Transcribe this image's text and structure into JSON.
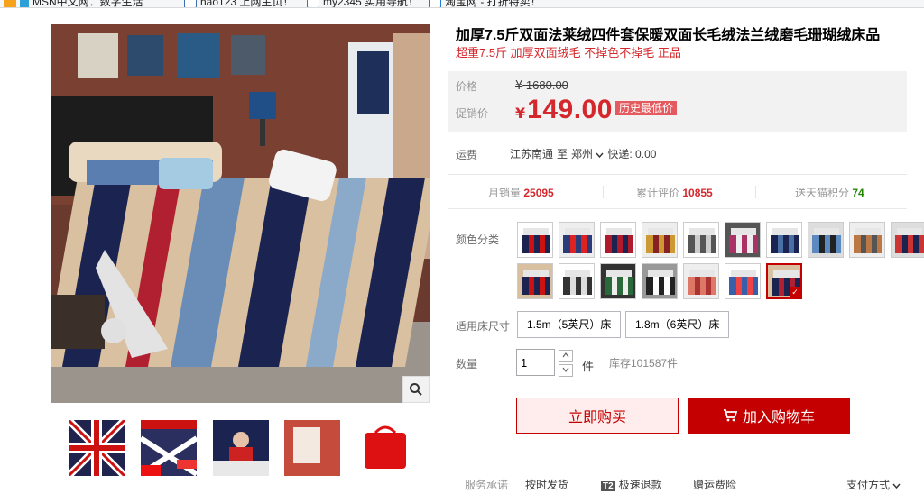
{
  "bookmarks": [
    {
      "label": "MSN中文网：数字生活",
      "icon": "msn-icon"
    },
    {
      "label": "hao123 上网主页！",
      "icon": "hao123-icon"
    },
    {
      "label": "my2345 实用导航！",
      "icon": "ie-icon"
    },
    {
      "label": "淘宝网 - 打折特卖！",
      "icon": "taobao-icon"
    }
  ],
  "product": {
    "title": "加厚7.5斤双面法莱绒四件套保暖双面长毛绒法兰绒磨毛珊瑚绒床品",
    "subtitle": "超重7.5斤 加厚双面绒毛 不掉色不掉毛 正品"
  },
  "price": {
    "orig_label": "价格",
    "orig_symbol": "¥",
    "orig_value": "1680.00",
    "promo_label": "促销价",
    "promo_symbol": "¥",
    "promo_value": "149.00",
    "promo_tag": "历史最低价"
  },
  "shipping": {
    "label": "运费",
    "from": "江苏南通",
    "to_word": "至",
    "to": "郑州",
    "express": "快递: 0.00"
  },
  "stats": {
    "monthly_label": "月销量",
    "monthly_value": "25095",
    "reviews_label": "累计评价",
    "reviews_value": "10855",
    "points_label": "送天猫积分",
    "points_value": "74"
  },
  "color": {
    "label": "颜色分类",
    "selected_index": 16,
    "swatch_count": 17
  },
  "size": {
    "label": "适用床尺寸",
    "options": [
      "1.5m（5英尺）床",
      "1.8m（6英尺）床"
    ]
  },
  "quantity": {
    "label": "数量",
    "value": "1",
    "unit": "件",
    "stock": "库存101587件"
  },
  "actions": {
    "buy": "立即购买",
    "cart": "加入购物车"
  },
  "services": {
    "label": "服务承诺",
    "items": [
      "按时发货",
      "极速退款",
      "赠运费险"
    ],
    "t2_badge": "T2",
    "payment": "支付方式"
  },
  "colors": {
    "accent": "#c40000",
    "price_red": "#d4282d",
    "price_bg": "#f2f2f2"
  }
}
